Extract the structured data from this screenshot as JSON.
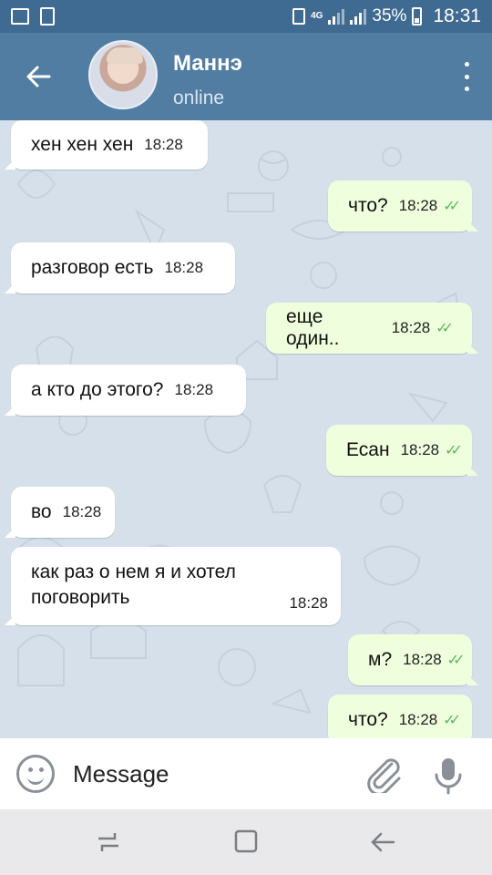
{
  "status_bar": {
    "network": "4G",
    "battery": "35%",
    "time": "18:31"
  },
  "header": {
    "back_icon": "arrow-left-icon",
    "contact_name": "Маннэ",
    "contact_status": "online",
    "menu_icon": "more-vert-icon"
  },
  "messages": [
    {
      "direction": "in",
      "text": "хен хен хен",
      "time": "18:28"
    },
    {
      "direction": "out",
      "text": "что?",
      "time": "18:28",
      "read": true
    },
    {
      "direction": "in",
      "text": "разговор есть",
      "time": "18:28"
    },
    {
      "direction": "out",
      "text": "еще один..",
      "time": "18:28",
      "read": true
    },
    {
      "direction": "in",
      "text": "а кто до этого?",
      "time": "18:28"
    },
    {
      "direction": "out",
      "text": "Есан",
      "time": "18:28",
      "read": true
    },
    {
      "direction": "in",
      "text": "во",
      "time": "18:28"
    },
    {
      "direction": "in",
      "text": "как раз о нем я и хотел\nпоговорить",
      "time": "18:28"
    },
    {
      "direction": "out",
      "text": "м?",
      "time": "18:28",
      "read": true
    },
    {
      "direction": "out",
      "text": "что?",
      "time": "18:28",
      "read": true
    }
  ],
  "input_bar": {
    "placeholder": "Message",
    "emoji_icon": "emoji-icon",
    "attach_icon": "paperclip-icon",
    "mic_icon": "microphone-icon"
  },
  "colors": {
    "header": "#517da2",
    "status_bar": "#3f6a92",
    "chat_bg": "#d6e0ea",
    "outgoing_bubble": "#effedd",
    "incoming_bubble": "#ffffff",
    "read_ticks": "#5cb85c"
  }
}
